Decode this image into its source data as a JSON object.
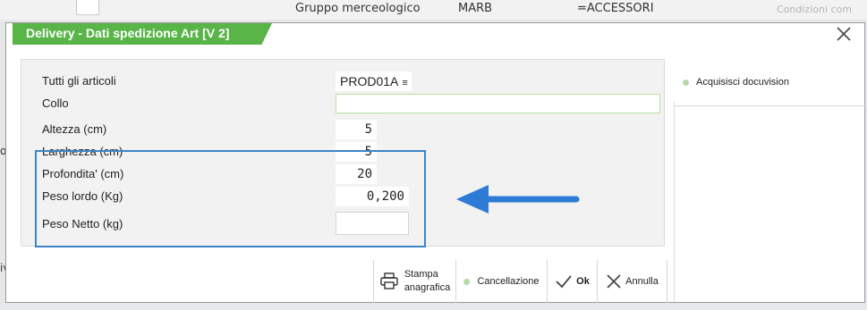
{
  "background": {
    "group_label": "Gruppo merceologico",
    "group_code": "MARB",
    "group_value": "=ACCESSORI",
    "right_label": "Condizioni com",
    "left_text_1": "ot",
    "left_text_2": "ivi"
  },
  "dialog": {
    "title": "Delivery - Dati spedizione Art [V 2]",
    "fields": [
      {
        "label": "Tutti gli articoli",
        "value": "PROD01A",
        "suffix": "≡"
      },
      {
        "label": "Collo",
        "value": ""
      },
      {
        "label": "Altezza (cm)",
        "value": "5"
      },
      {
        "label": "Larghezza (cm)",
        "value": "5"
      },
      {
        "label": "Profondita' (cm)",
        "value": "20"
      },
      {
        "label": "Peso lordo (Kg)",
        "value": "0,200"
      },
      {
        "label": "Peso Netto (kg)",
        "value": ""
      }
    ],
    "side_panel": {
      "item": "Acquisisci docuvision"
    },
    "toolbar": {
      "stampa_line1": "Stampa",
      "stampa_line2": "anagrafica",
      "cancellazione": "Cancellazione",
      "ok": "Ok",
      "annulla": "Annulla"
    }
  },
  "colors": {
    "title_bar": "#59b548",
    "highlight": "#3d85c6",
    "arrow": "#2e7bd6"
  },
  "icons": [
    "close-icon",
    "menu-lines-icon",
    "printer-icon",
    "dot-icon",
    "check-icon",
    "x-icon",
    "arrow-left-icon"
  ]
}
